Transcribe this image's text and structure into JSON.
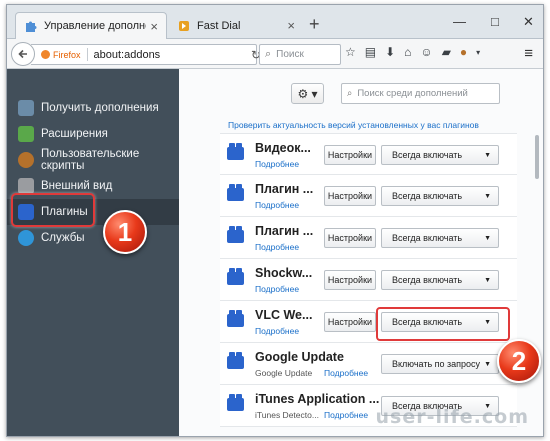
{
  "window": {
    "tabs": [
      {
        "title": "Управление дополнения...",
        "close": "×"
      },
      {
        "title": "Fast Dial",
        "close": "×"
      }
    ],
    "new_tab": "+",
    "controls": {
      "minimize": "—",
      "maximize": "□",
      "close": "✕"
    }
  },
  "navbar": {
    "brand": "Firefox",
    "url": "about:addons",
    "search_placeholder": "Поиск"
  },
  "sidebar": {
    "items": [
      {
        "label": "Получить дополнения",
        "icon": "puzzle-download-icon",
        "color": "#6b8ca8"
      },
      {
        "label": "Расширения",
        "icon": "puzzle-piece-icon",
        "color": "#5aa84a"
      },
      {
        "label": "Пользовательские скрипты",
        "icon": "monkey-icon",
        "color": "#b5712b"
      },
      {
        "label": "Внешний вид",
        "icon": "paint-brush-icon",
        "color": "#9a9ca0"
      },
      {
        "label": "Плагины",
        "icon": "lego-brick-icon",
        "color": "#2b64cc"
      },
      {
        "label": "Службы",
        "icon": "service-bubble-icon",
        "color": "#2f95d8"
      }
    ],
    "active_index": 4
  },
  "main": {
    "gear_label": "⚙ ▾",
    "search_placeholder": "Поиск среди дополнений",
    "check_link": "Проверить актуальность версий установленных у вас плагинов",
    "plugins": [
      {
        "name": "Видеок...",
        "desc": "",
        "more": "Подробнее",
        "settings": "Настройки",
        "state": "Всегда включать"
      },
      {
        "name": "Плагин ...",
        "desc": "",
        "more": "Подробнее",
        "settings": "Настройки",
        "state": "Всегда включать"
      },
      {
        "name": "Плагин ...",
        "desc": "",
        "more": "Подробнее",
        "settings": "Настройки",
        "state": "Всегда включать"
      },
      {
        "name": "Shockw...",
        "desc": "",
        "more": "Подробнее",
        "settings": "Настройки",
        "state": "Всегда включать"
      },
      {
        "name": "VLC We...",
        "desc": "",
        "more": "Подробнее",
        "settings": "Настройки",
        "state": "Всегда включать"
      },
      {
        "name": "Google Update",
        "desc": "Google Update",
        "more": "Подробнее",
        "settings": "",
        "state": "Включать по запросу"
      },
      {
        "name": "iTunes Application ...",
        "desc": "iTunes Detecto...",
        "more": "Подробнее",
        "settings": "",
        "state": "Всегда включать"
      }
    ]
  },
  "annotations": {
    "badge_1": "1",
    "badge_2": "2",
    "highlight_color": "#e03a3a"
  },
  "watermark": "user-life.com"
}
